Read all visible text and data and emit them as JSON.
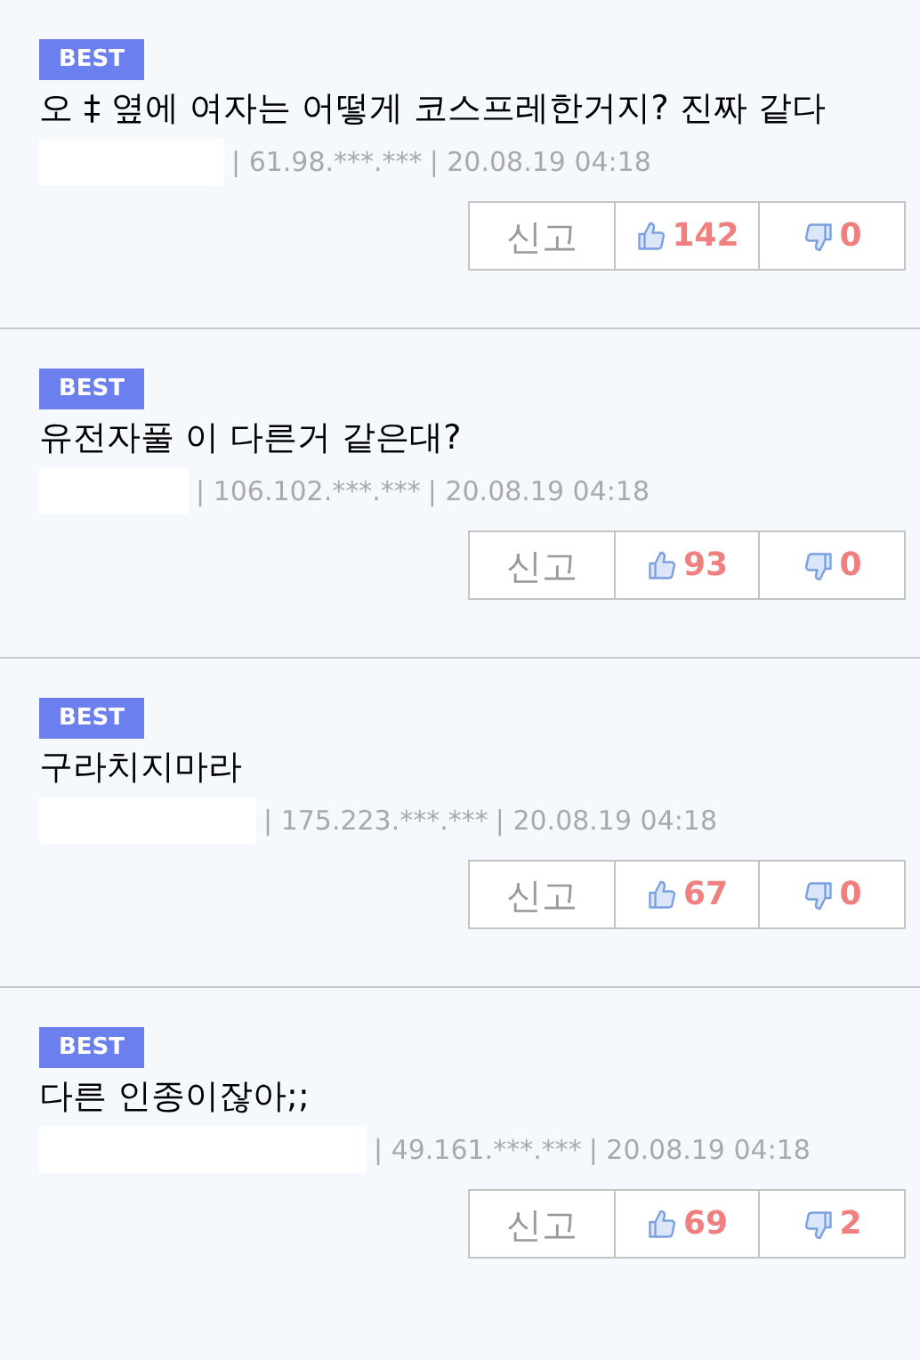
{
  "comments": [
    {
      "badge": "BEST",
      "text": "오 ‡  옆에 여자는 어떻게 코스프레한거지? 진짜 같다",
      "ip": "| 61.98.***.***",
      "date": "| 20.08.19 04:18",
      "report": "신고",
      "likes": "142",
      "dislikes": "0"
    },
    {
      "badge": "BEST",
      "text": "유전자풀 이 다른거 같은대?",
      "ip": "| 106.102.***.***",
      "date": "| 20.08.19 04:18",
      "report": "신고",
      "likes": "93",
      "dislikes": "0"
    },
    {
      "badge": "BEST",
      "text": "구라치지마라",
      "ip": "| 175.223.***.***",
      "date": "| 20.08.19 04:18",
      "report": "신고",
      "likes": "67",
      "dislikes": "0"
    },
    {
      "badge": "BEST",
      "text": "다른 인종이잖아;;",
      "ip": "| 49.161.***.***",
      "date": "| 20.08.19 04:18",
      "report": "신고",
      "likes": "69",
      "dislikes": "2"
    }
  ]
}
